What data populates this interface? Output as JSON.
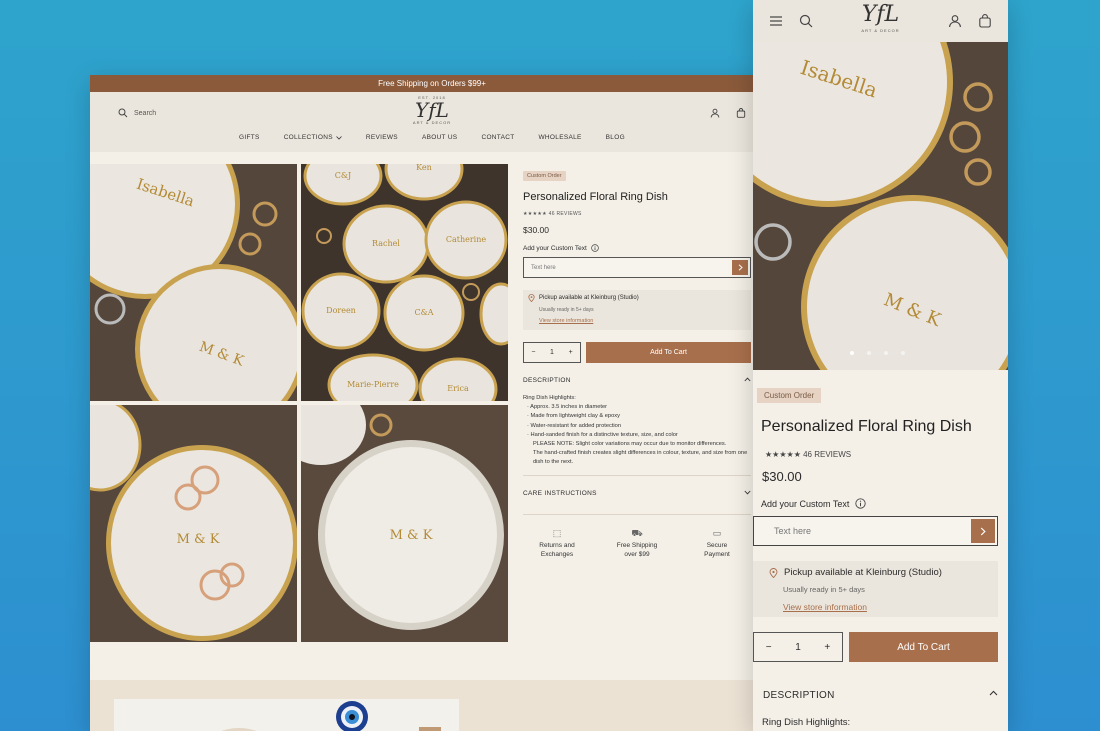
{
  "desktop": {
    "announcement": "Free Shipping on Orders $99+",
    "search_label": "Search",
    "logo": {
      "est": "EST. 2018",
      "mark": "YfL",
      "sub": "ART & DECOR"
    },
    "nav": [
      "GIFTS",
      "COLLECTIONS",
      "REVIEWS",
      "ABOUT US",
      "CONTACT",
      "WHOLESALE",
      "BLOG"
    ],
    "gallery_names": {
      "t1": [
        "Isabella",
        "M & K"
      ],
      "t2": [
        "C&J",
        "Rachel",
        "Catherine",
        "Doreen",
        "C&A",
        "Marie-Pierre",
        "Erica",
        "Ken"
      ],
      "t3": [
        "M & K"
      ],
      "t4": [
        "M & K"
      ]
    },
    "product": {
      "badge": "Custom Order",
      "title": "Personalized Floral Ring Dish",
      "stars": "★★★★★",
      "reviews": "46 REVIEWS",
      "price": "$30.00",
      "custom_label": "Add your Custom Text",
      "input_placeholder": "Text here",
      "pickup_line": "Pickup available at Kleinburg (Studio)",
      "pickup_ready": "Usually ready in 5+ days",
      "pickup_link": "View store information",
      "qty": "1",
      "add_to_cart": "Add To Cart",
      "description_title": "DESCRIPTION",
      "description_intro": "Ring Dish Highlights:",
      "description_bullets": [
        "Approx. 3.5 inches in diameter",
        "Made from lightweight clay & epoxy",
        "Water-resistant for added protection",
        "Hand-sanded finish for a distinctive texture, size, and color"
      ],
      "note_1": "PLEASE NOTE: Slight color variations may occur due to monitor differences.",
      "note_2": "The hand-crafted finish creates slight differences in colour, texture, and size from one dish to the next.",
      "care_title": "CARE INSTRUCTIONS",
      "perks": [
        {
          "icon": "box-icon",
          "glyph": "⬚",
          "line1": "Returns and",
          "line2": "Exchanges"
        },
        {
          "icon": "truck-icon",
          "glyph": "⛟",
          "line1": "Free Shipping",
          "line2": "over $99"
        },
        {
          "icon": "card-icon",
          "glyph": "▭",
          "line1": "Secure",
          "line2": "Payment"
        }
      ]
    }
  },
  "mobile": {
    "logo": {
      "mark": "YfL",
      "sub": "ART & DECOR"
    },
    "hero_names": [
      "Isabella",
      "M & K"
    ],
    "badge": "Custom Order",
    "title": "Personalized Floral Ring Dish",
    "stars": "★★★★★",
    "reviews": "46 REVIEWS",
    "price": "$30.00",
    "custom_label": "Add your Custom Text",
    "input_placeholder": "Text here",
    "pickup_line": "Pickup available at Kleinburg (Studio)",
    "pickup_ready": "Usually ready in 5+ days",
    "pickup_link": "View store information",
    "qty": "1",
    "add_to_cart": "Add To Cart",
    "description_title": "DESCRIPTION",
    "description_intro": "Ring Dish Highlights:"
  },
  "colors": {
    "accent": "#a86f4c",
    "announce": "#8a5a3b",
    "page_bg": "#f4f0e8",
    "badge_bg": "#e6d3c4"
  }
}
